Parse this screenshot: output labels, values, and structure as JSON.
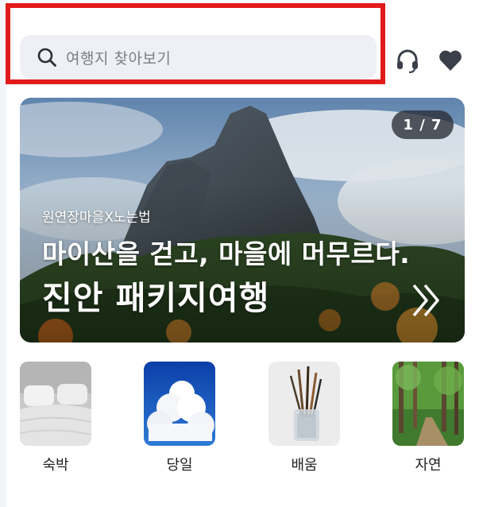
{
  "search": {
    "placeholder": "여행지 찾아보기"
  },
  "header_icons": [
    "headset-icon",
    "heart-icon"
  ],
  "banner": {
    "page_indicator": "1 / 7",
    "subtitle": "원연장마을X노는법",
    "headline": "마이산을 걷고, 마을에 머무르다.",
    "title": "진안 패키지여행"
  },
  "categories": [
    {
      "label": "숙박",
      "icon": "bed-image"
    },
    {
      "label": "당일",
      "icon": "cloud-sky-image"
    },
    {
      "label": "배움",
      "icon": "paintbrush-cup-image"
    },
    {
      "label": "자연",
      "icon": "forest-path-image"
    }
  ],
  "colors": {
    "highlight": "#e11b1b",
    "search_bg": "#eef0f5",
    "icon": "#3a3f4a"
  }
}
